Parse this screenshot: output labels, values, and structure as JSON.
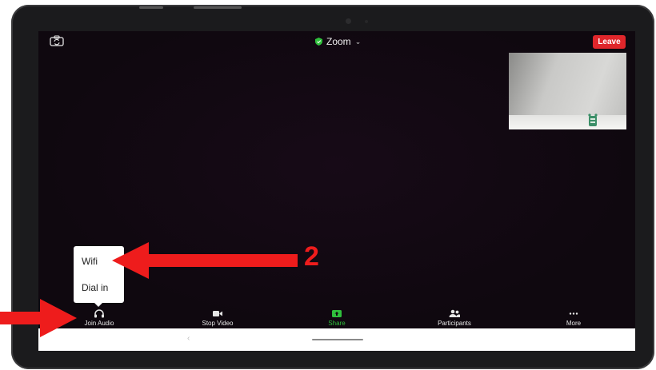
{
  "meeting": {
    "title": "Zoom",
    "title_chevron": "⌄",
    "leave_label": "Leave"
  },
  "audio_menu": {
    "items": [
      {
        "label": "Wifi"
      },
      {
        "label": "Dial in"
      }
    ]
  },
  "toolbar": {
    "items": [
      {
        "label": "Join Audio",
        "icon": "headphones-icon"
      },
      {
        "label": "Stop Video",
        "icon": "video-camera-icon"
      },
      {
        "label": "Share",
        "icon": "share-screen-icon"
      },
      {
        "label": "Participants",
        "icon": "participants-icon"
      },
      {
        "label": "More",
        "icon": "more-dots-icon"
      }
    ]
  },
  "navbar": {
    "back_glyph": "‹"
  },
  "annotation": {
    "step_number": "2",
    "color": "#ee1c1c"
  },
  "colors": {
    "leave": "#e0262b",
    "share": "#2fbf3c",
    "background": "#0f080f"
  }
}
